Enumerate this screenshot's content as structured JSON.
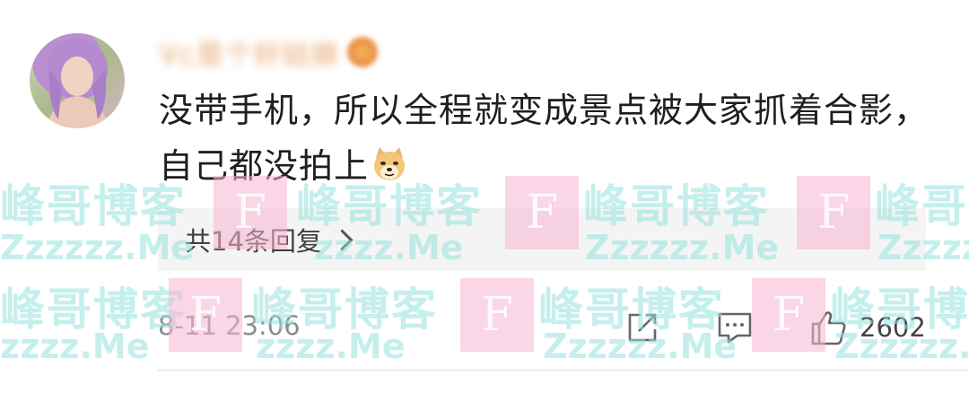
{
  "comment": {
    "username": "Vc是个好姑娘",
    "text": "没带手机，所以全程就变成景点被大家抓着合影，自己都没拍上",
    "emoji": "doge-emoji",
    "replies_label": "共14条回复",
    "timestamp": "8-11 23:06",
    "like_count": "2602"
  },
  "watermark": {
    "brand": "峰哥博客",
    "url_long": "Zzzzzz.Me",
    "url_short": "zzzz.Me",
    "logo_letter": "F"
  },
  "icons": {
    "share": "share-icon",
    "comment": "comment-icon",
    "like": "thumbs-up-icon"
  },
  "colors": {
    "watermark_text": "#96e1dc",
    "watermark_box": "#f5b4d2",
    "text": "#1f1f1f",
    "muted": "#8c8c8c",
    "reply_bg": "#f4f4f4"
  }
}
